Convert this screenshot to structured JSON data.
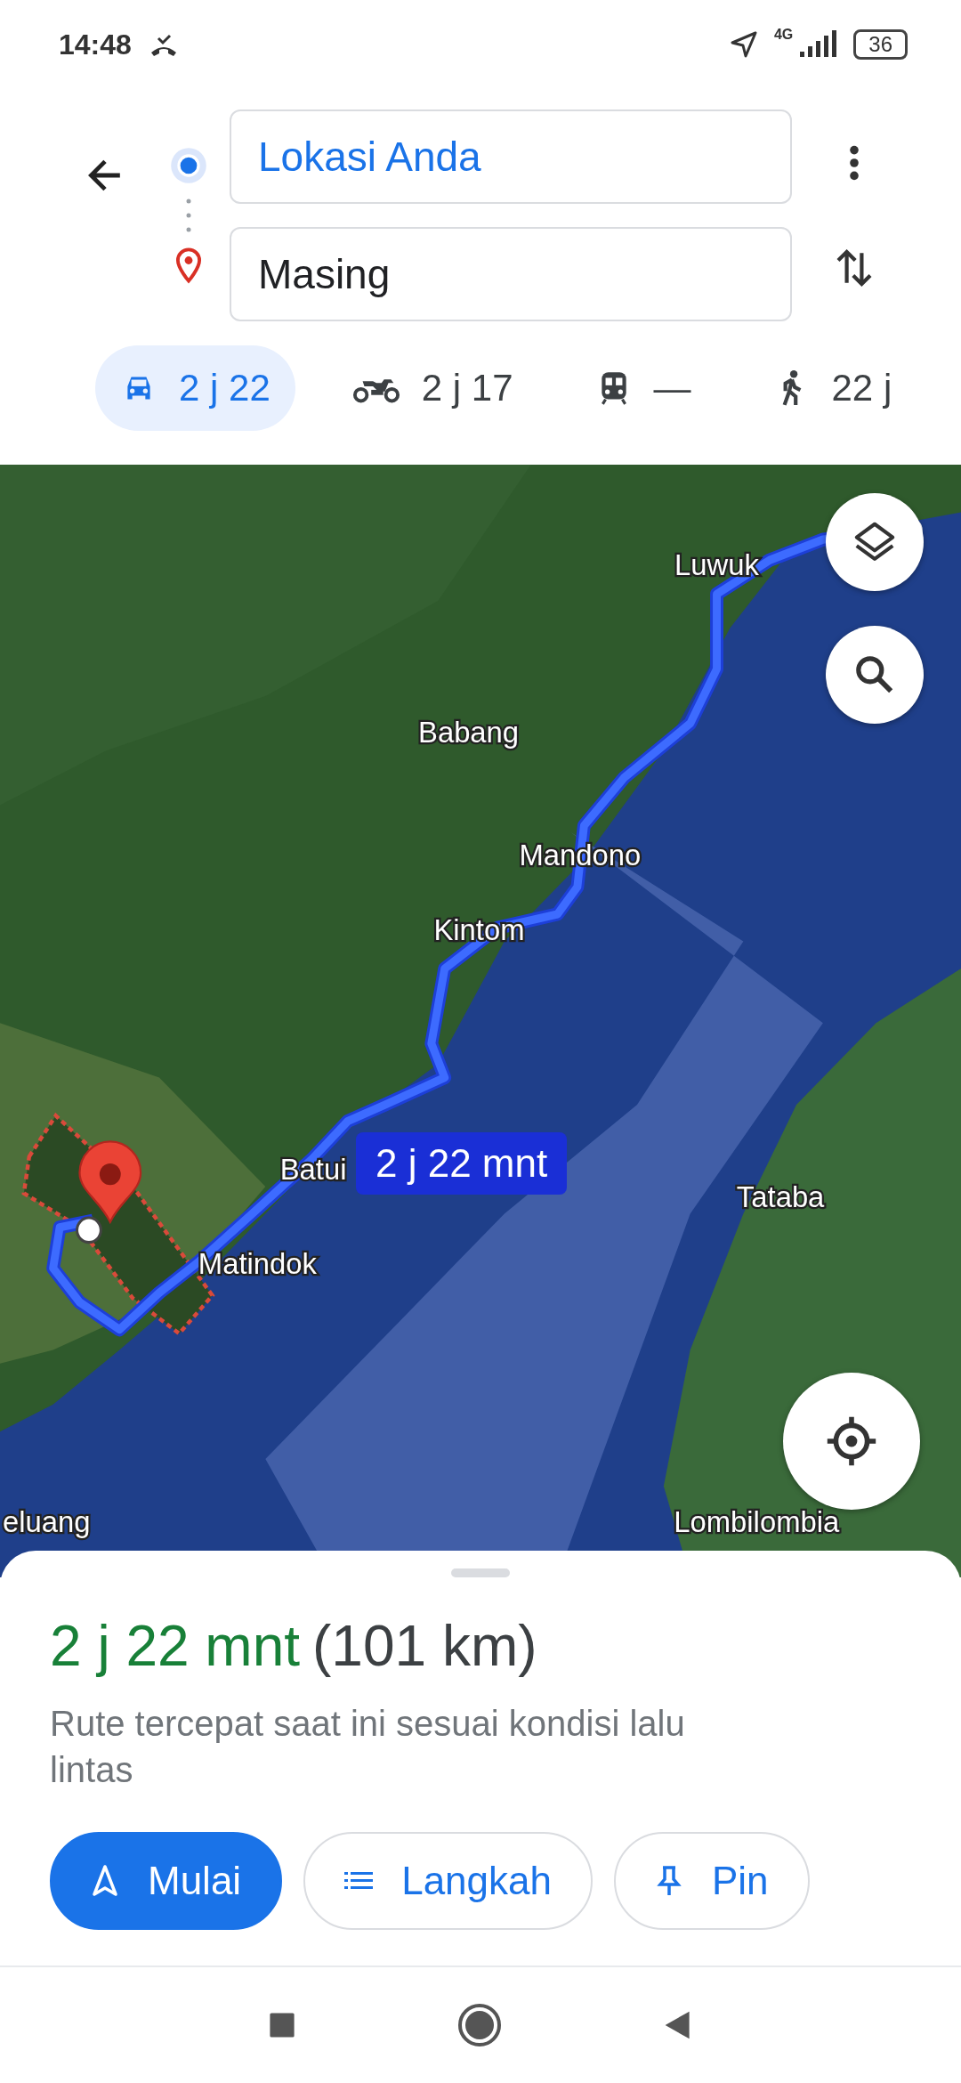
{
  "status_bar": {
    "time": "14:48",
    "network": "4G",
    "battery": "36"
  },
  "directions": {
    "origin": "Lokasi Anda",
    "destination": "Masing"
  },
  "modes": [
    {
      "kind": "car",
      "label": "2 j 22",
      "selected": true
    },
    {
      "kind": "motorcycle",
      "label": "2 j 17",
      "selected": false
    },
    {
      "kind": "transit",
      "label": "—",
      "selected": false
    },
    {
      "kind": "walk",
      "label": "22 j",
      "selected": false
    }
  ],
  "map": {
    "labels": [
      "Luwuk",
      "Babang",
      "Mandono",
      "Kintom",
      "Batui",
      "Matindok",
      "Tataba",
      "Lombilombia",
      "eluang"
    ],
    "route_label": "2 j 22 mnt"
  },
  "summary": {
    "duration": "2 j 22 mnt",
    "distance": "(101 km)",
    "note": "Rute tercepat saat ini sesuai kondisi lalu lintas"
  },
  "actions": [
    {
      "kind": "start",
      "label": "Mulai"
    },
    {
      "kind": "steps",
      "label": "Langkah"
    },
    {
      "kind": "pin",
      "label": "Pin"
    }
  ]
}
